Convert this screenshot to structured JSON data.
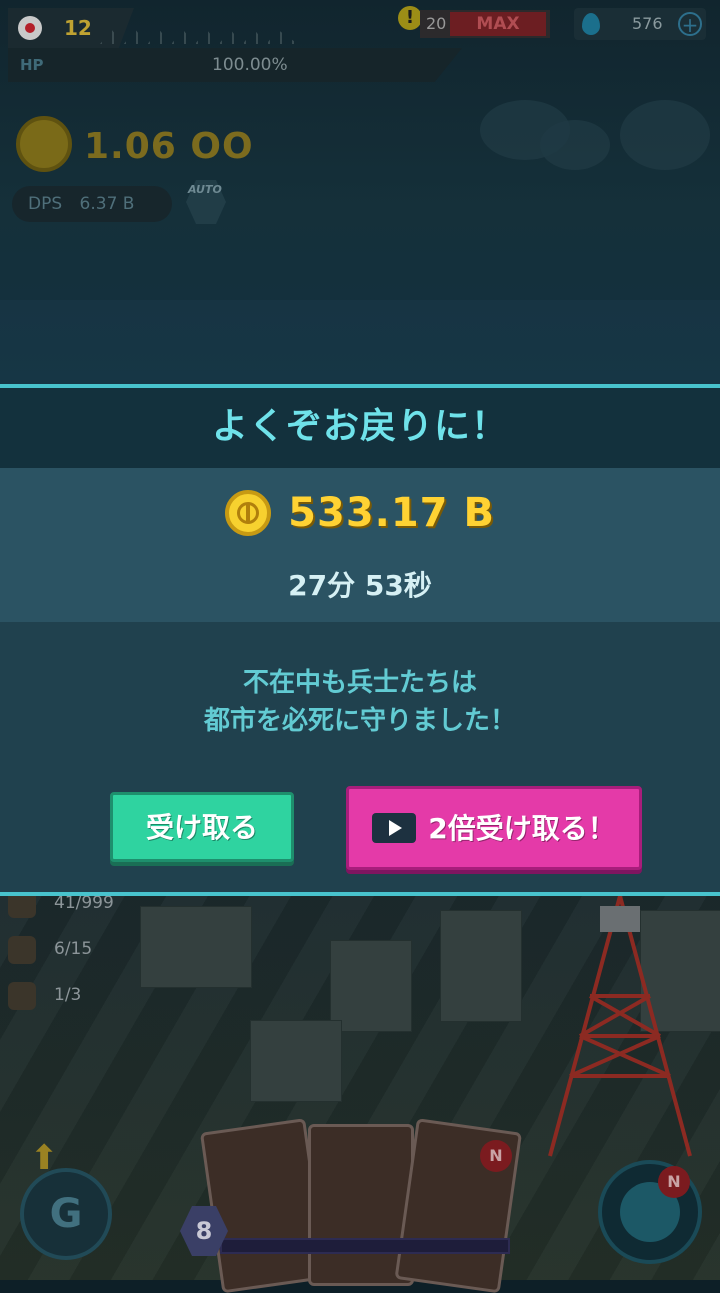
{
  "hud": {
    "level": "12",
    "hp_label": "HP",
    "hp_percent": "100.00%",
    "alert": "!",
    "energy_count": "20",
    "energy_status": "MAX",
    "gems": "576",
    "gems_plus": "+",
    "coins": "1.06 OO",
    "dps_label": "DPS",
    "dps_value": "6.37 B",
    "auto_label": "AUTO"
  },
  "bottom": {
    "stats": [
      {
        "value": "41/999"
      },
      {
        "value": "6/15"
      },
      {
        "value": "1/3"
      }
    ],
    "g_button": "G",
    "card_badge": "N",
    "globe_badge": "N",
    "rank": "8"
  },
  "modal": {
    "title": "よくぞお戻りに！",
    "reward_amount": "533.17 B",
    "duration": "27分  53秒",
    "message_line1": "不在中も兵士たちは",
    "message_line2": "都市を必死に守りました！",
    "receive_label": "受け取る",
    "double_label": "2倍受け取る！"
  },
  "colors": {
    "accent": "#48c3cd",
    "title": "#6fe2ea",
    "gold": "#ffd233",
    "receive_button": "#2fd3a0",
    "double_button": "#e43aa8"
  }
}
